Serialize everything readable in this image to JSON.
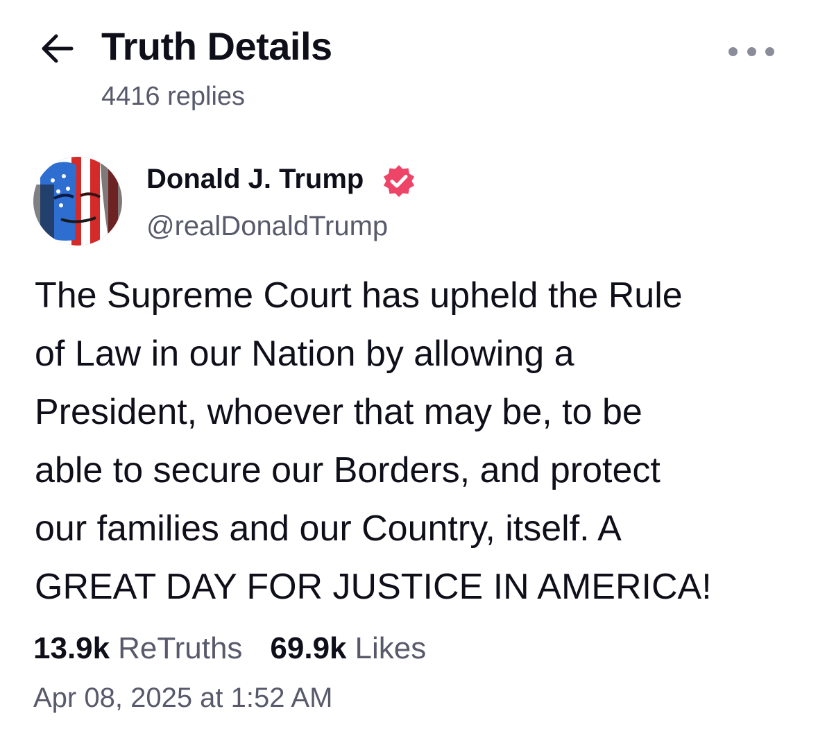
{
  "header": {
    "title": "Truth Details",
    "replies_text": "4416 replies",
    "back_icon": "arrow-left-icon",
    "more_icon": "more-horizontal-icon"
  },
  "post": {
    "author": {
      "name": "Donald J. Trump",
      "handle": "@realDonaldTrump",
      "verified": true,
      "verified_color": "#ee4467"
    },
    "body": "The Supreme Court has upheld the Rule\nof Law in our Nation by allowing a\nPresident, whoever that may be, to be\nable to secure our Borders, and protect\nour families and our Country, itself. A\nGREAT DAY FOR JUSTICE IN AMERICA!",
    "stats": {
      "retruths_count": "13.9k",
      "retruths_label": "ReTruths",
      "likes_count": "69.9k",
      "likes_label": "Likes"
    },
    "timestamp": "Apr 08, 2025 at 1:52 AM"
  },
  "colors": {
    "text_primary": "#0f0f1a",
    "text_secondary": "#585a6b",
    "background": "#ffffff"
  }
}
